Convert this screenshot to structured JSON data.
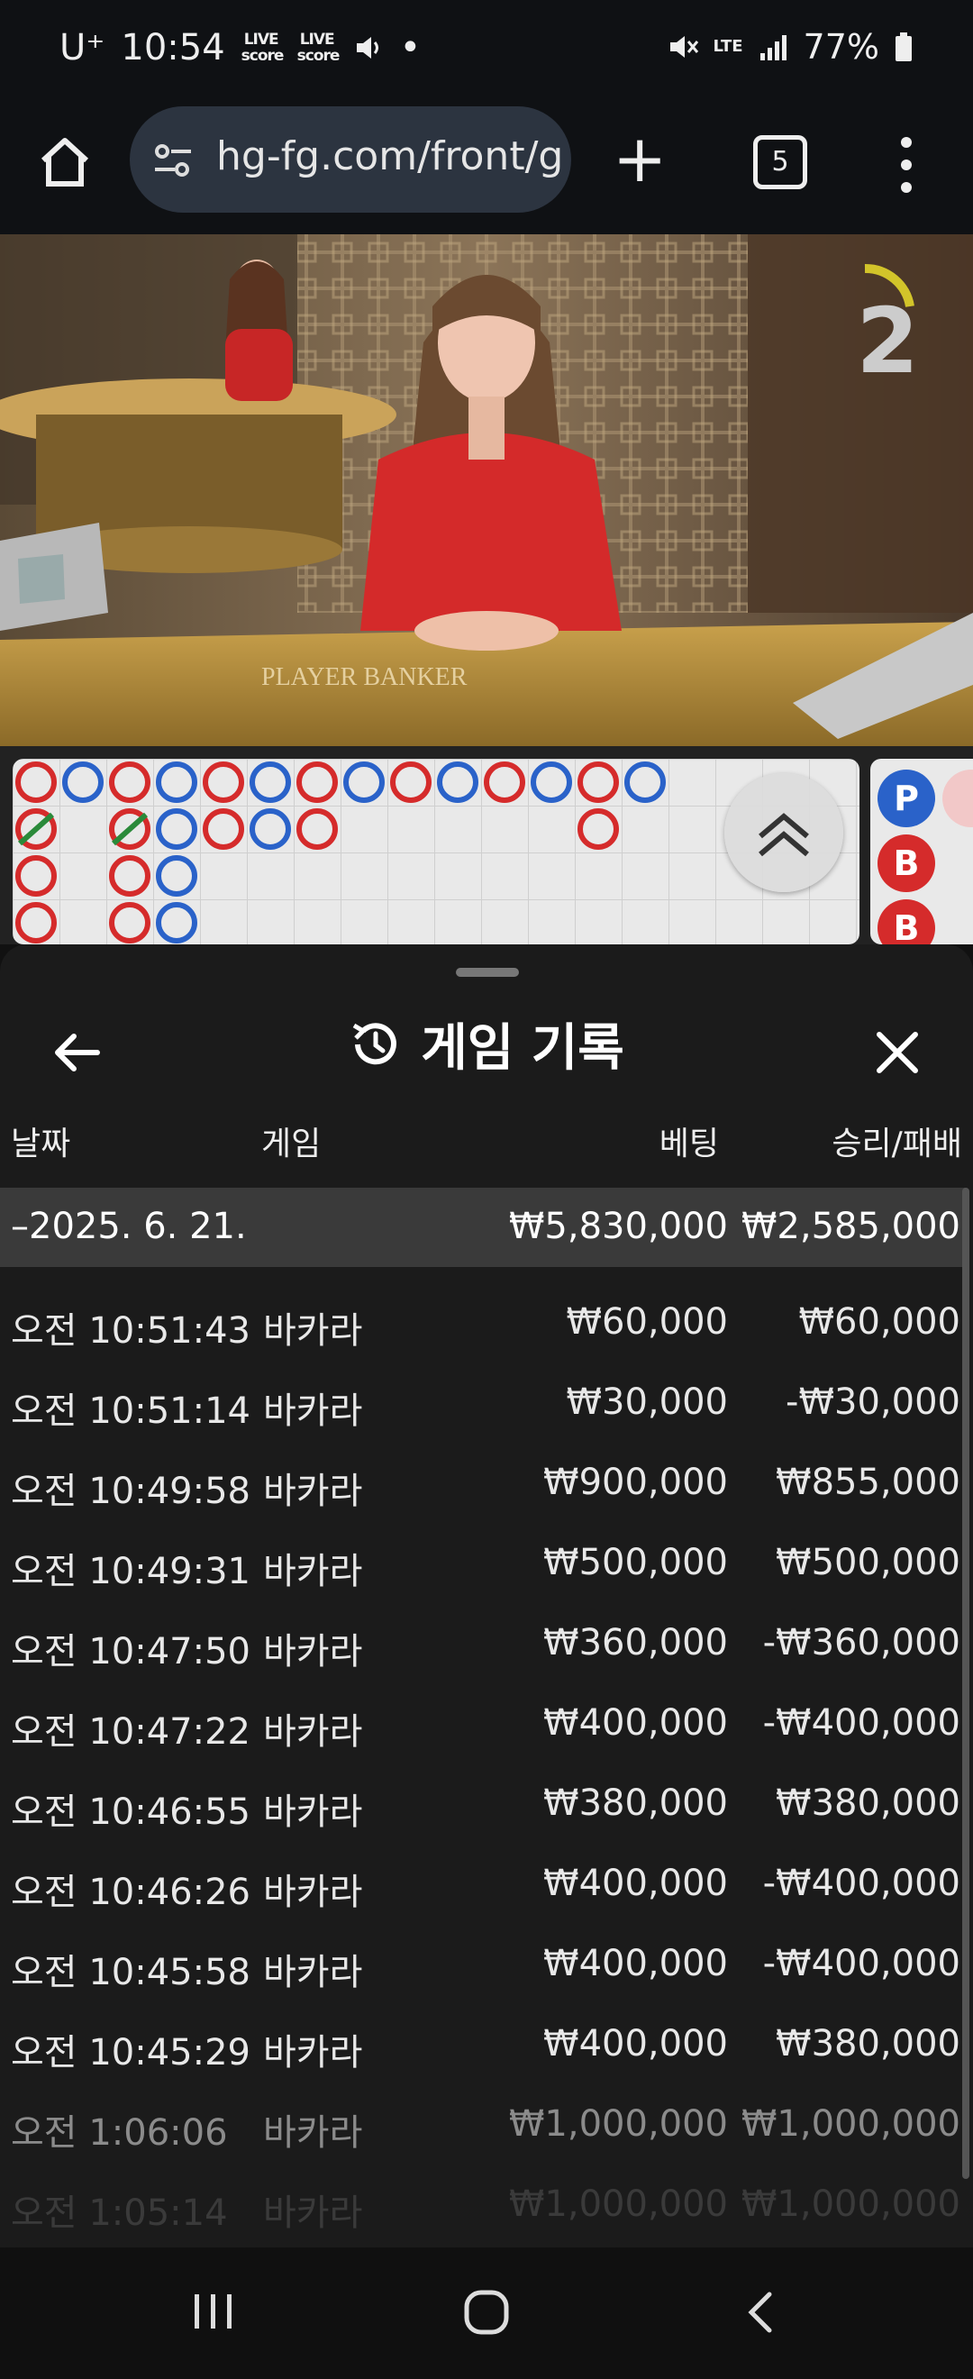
{
  "status_bar": {
    "carrier": "U⁺",
    "time": "10:54",
    "live_badge_1": "LIVE score",
    "live_badge_2": "LIVE score",
    "dot": "•",
    "network": "LTE",
    "battery": "77%"
  },
  "browser": {
    "url": "hg-fg.com/front/g",
    "tab_count": "5",
    "icons": [
      "home-icon",
      "site-settings-icon",
      "new-tab-icon",
      "tab-switcher-icon",
      "more-icon"
    ]
  },
  "video": {
    "round_number": "2",
    "table_text": "PLAYER    BANKER"
  },
  "road_side": {
    "cells": [
      "P",
      "B",
      "B"
    ]
  },
  "sheet": {
    "title": "게임 기록",
    "columns": {
      "date": "날짜",
      "game": "게임",
      "bet": "베팅",
      "result": "승리/패배"
    },
    "date_group": {
      "date": "–2025. 6. 21.",
      "bet": "₩5,830,000",
      "result": "₩2,585,000"
    },
    "rows": [
      {
        "date": "오전 10:51:43",
        "game": "바카라",
        "bet": "₩60,000",
        "result": "₩60,000"
      },
      {
        "date": "오전 10:51:14",
        "game": "바카라",
        "bet": "₩30,000",
        "result": "-₩30,000"
      },
      {
        "date": "오전 10:49:58",
        "game": "바카라",
        "bet": "₩900,000",
        "result": "₩855,000"
      },
      {
        "date": "오전 10:49:31",
        "game": "바카라",
        "bet": "₩500,000",
        "result": "₩500,000"
      },
      {
        "date": "오전 10:47:50",
        "game": "바카라",
        "bet": "₩360,000",
        "result": "-₩360,000"
      },
      {
        "date": "오전 10:47:22",
        "game": "바카라",
        "bet": "₩400,000",
        "result": "-₩400,000"
      },
      {
        "date": "오전 10:46:55",
        "game": "바카라",
        "bet": "₩380,000",
        "result": "₩380,000"
      },
      {
        "date": "오전 10:46:26",
        "game": "바카라",
        "bet": "₩400,000",
        "result": "-₩400,000"
      },
      {
        "date": "오전 10:45:58",
        "game": "바카라",
        "bet": "₩400,000",
        "result": "-₩400,000"
      },
      {
        "date": "오전 10:45:29",
        "game": "바카라",
        "bet": "₩400,000",
        "result": "₩380,000"
      },
      {
        "date": "오전 1:06:06",
        "game": "바카라",
        "bet": "₩1,000,000",
        "result": "₩1,000,000"
      },
      {
        "date": "오전 1:05:14",
        "game": "바카라",
        "bet": "₩1,000,000",
        "result": "₩1,000,000"
      }
    ]
  },
  "colors": {
    "player_blue": "#2a62c9",
    "banker_red": "#d52b2b",
    "tie_green": "#2a8a3a",
    "sheet_bg": "#1b1b1b"
  }
}
